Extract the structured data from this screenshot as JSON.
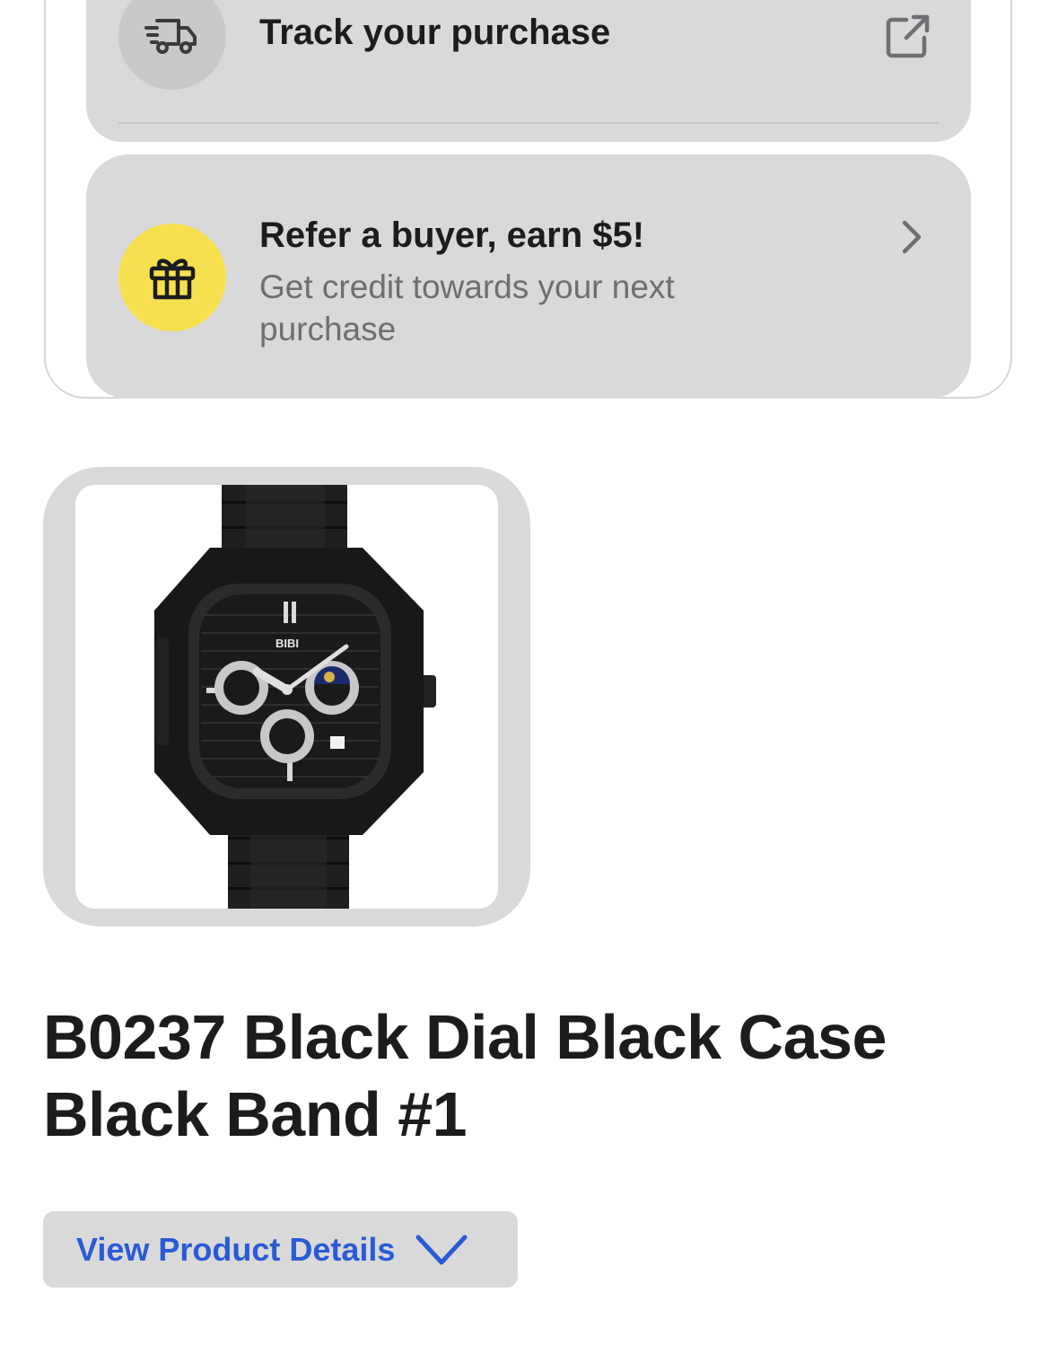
{
  "order_actions": {
    "track": {
      "label": "Track your purchase",
      "icon": "delivery-truck-icon",
      "action_icon": "external-link-icon"
    },
    "refer": {
      "title": "Refer a buyer, earn $5!",
      "subtitle": "Get credit towards your next purchase",
      "icon": "gift-icon",
      "action_icon": "chevron-right-icon",
      "icon_bg_color": "#f7e04f"
    }
  },
  "product": {
    "image": "watch-product-image",
    "dial_brand_text": "BIBI",
    "title": "B0237 Black Dial Black Case Black Band #1",
    "details_button_label": "View Product Details",
    "details_button_icon": "chevron-down-icon",
    "accent_color": "#2a5bd7"
  }
}
